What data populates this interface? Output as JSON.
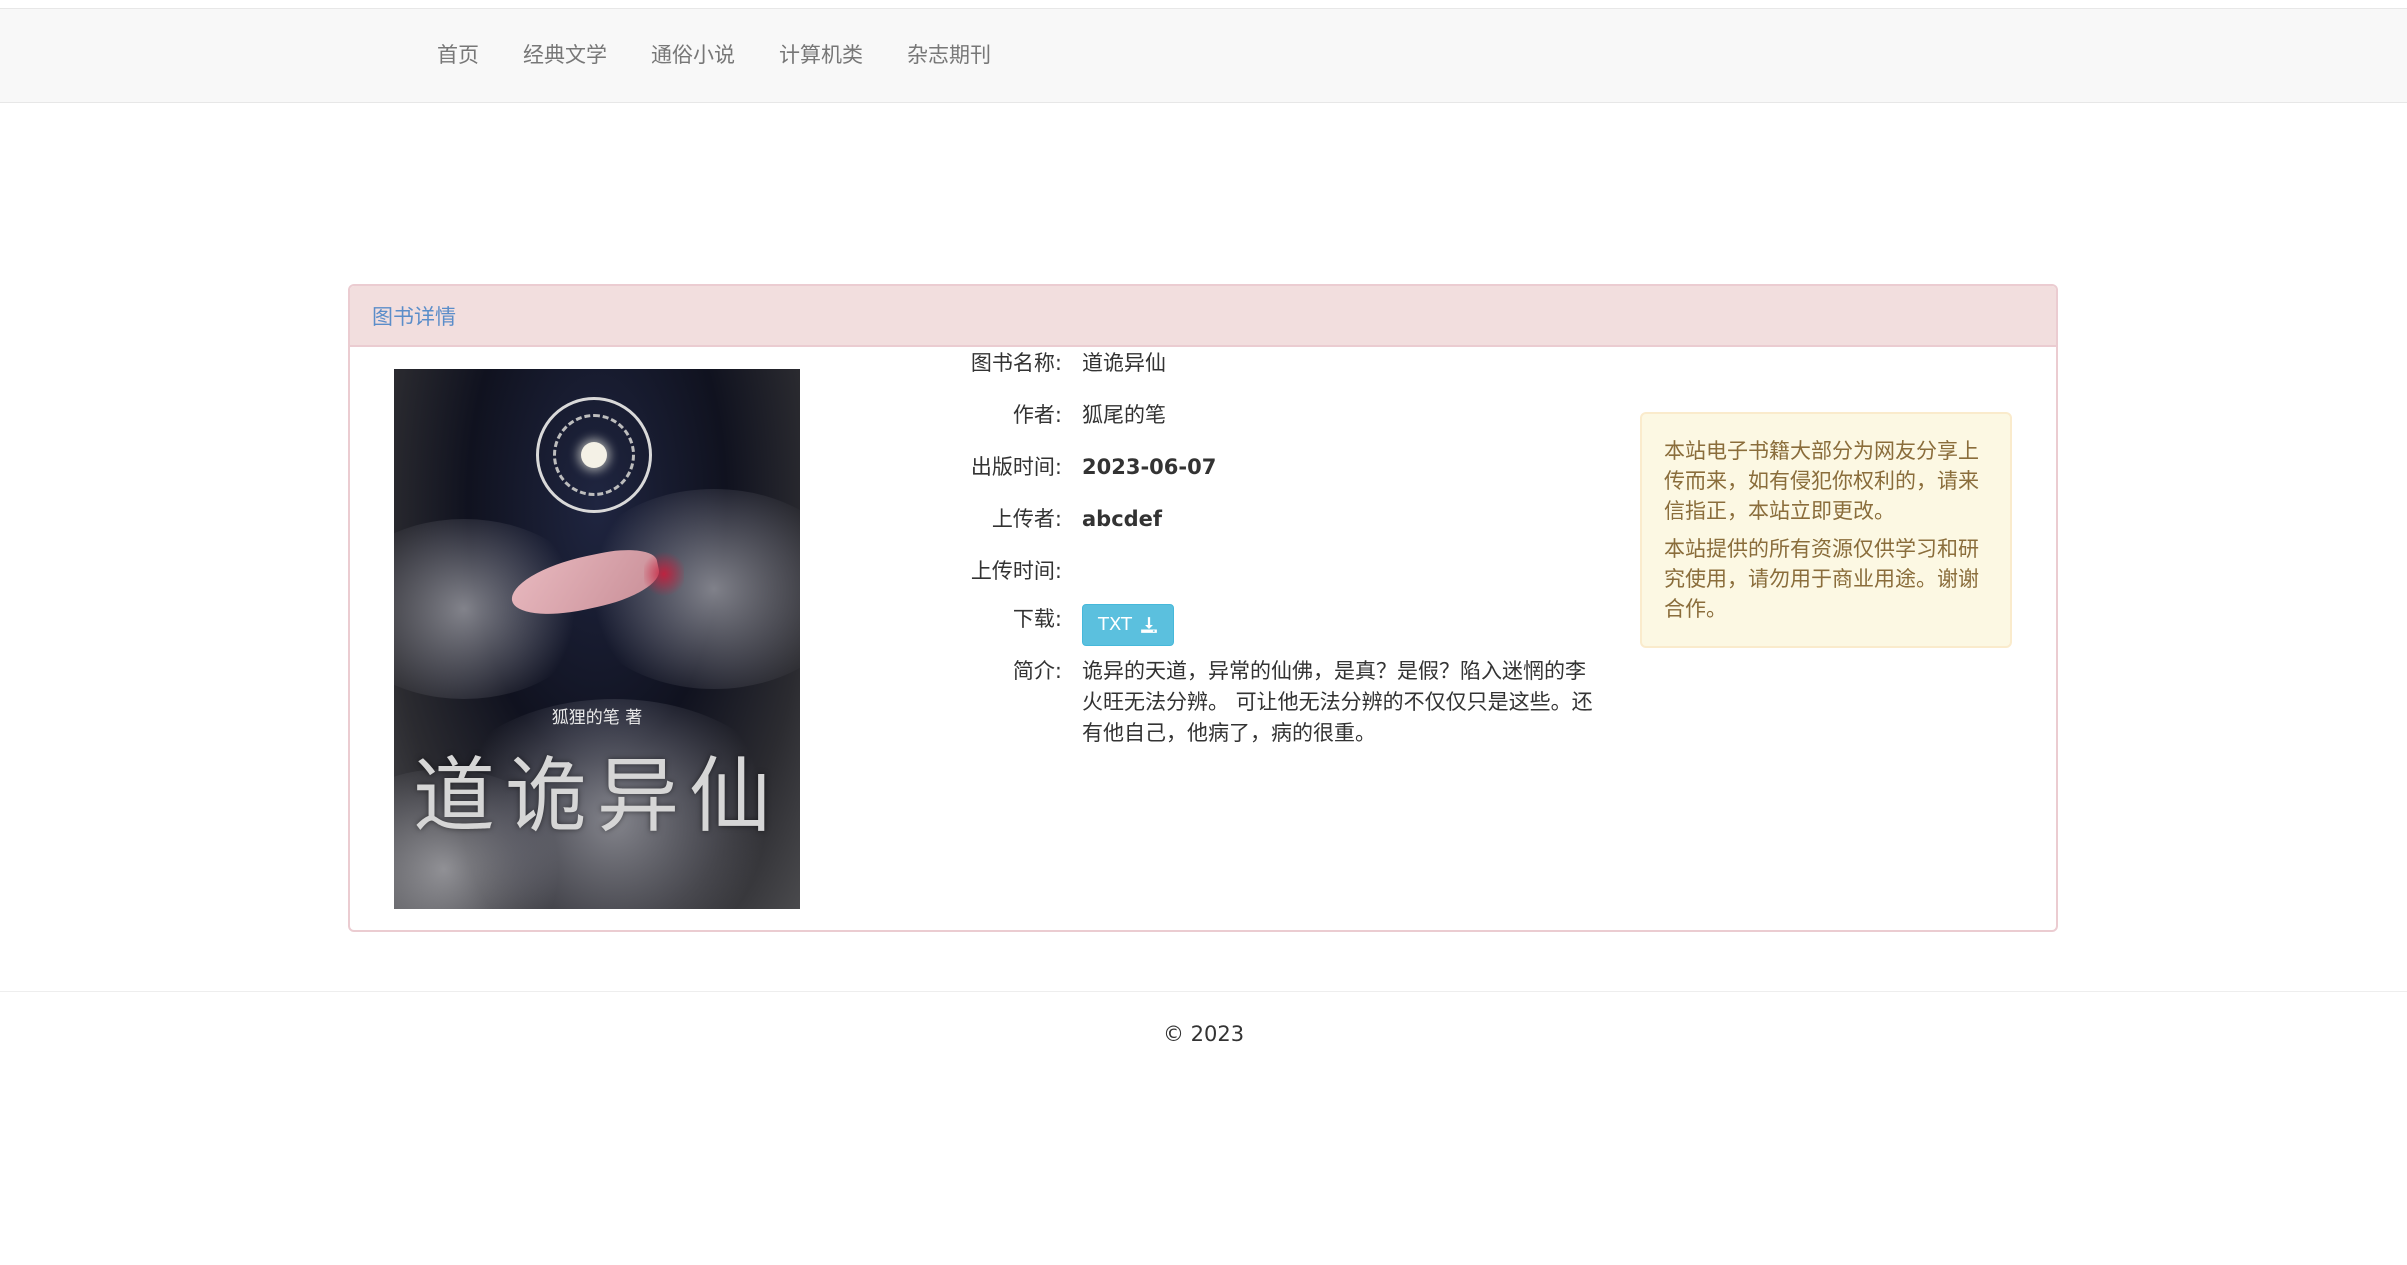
{
  "nav": {
    "items": [
      {
        "label": "首页"
      },
      {
        "label": "经典文学"
      },
      {
        "label": "通俗小说"
      },
      {
        "label": "计算机类"
      },
      {
        "label": "杂志期刊"
      }
    ]
  },
  "panel": {
    "heading": "图书详情"
  },
  "cover": {
    "author_text": "狐狸的笔 著",
    "title_text": "道诡异仙"
  },
  "book": {
    "name_label": "图书名称:",
    "name": "道诡异仙",
    "author_label": "作者:",
    "author": "狐尾的笔",
    "publish_label": "出版时间:",
    "publish_date": "2023-06-07",
    "uploader_label": "上传者:",
    "uploader": "abcdef",
    "upload_time_label": "上传时间:",
    "upload_time": "",
    "download_label": "下载:",
    "download_button": "TXT",
    "intro_label": "简介:",
    "intro": "诡异的天道，异常的仙佛，是真？是假？陷入迷惘的李火旺无法分辨。 可让他无法分辨的不仅仅只是这些。还有他自己，他病了，病的很重。"
  },
  "notice": {
    "p1": "本站电子书籍大部分为网友分享上传而来，如有侵犯你权利的，请来信指正，本站立即更改。",
    "p2": "本站提供的所有资源仅供学习和研究使用，请勿用于商业用途。谢谢合作。"
  },
  "footer": {
    "copyright": "© 2023"
  },
  "colors": {
    "panel_heading_bg": "#f2dede",
    "panel_heading_text": "#5b8dc9",
    "download_button_bg": "#5bc0de",
    "notice_bg": "#fcf8e3",
    "notice_text": "#8a6d3b"
  }
}
